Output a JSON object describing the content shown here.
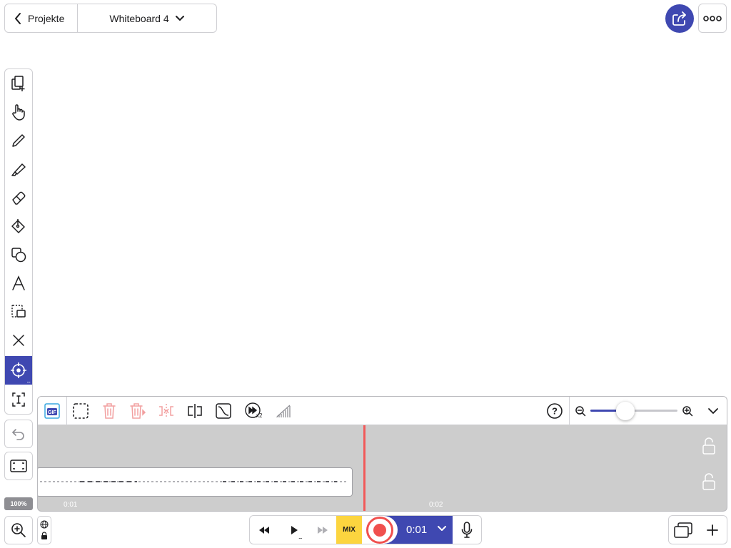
{
  "header": {
    "back_label": "Projekte",
    "title": "Whiteboard 4"
  },
  "toolbar": {
    "tools": [
      "add-page-icon",
      "hand-icon",
      "pen-icon",
      "marker-icon",
      "eraser-icon",
      "fill-bucket-icon",
      "shapes-icon",
      "text-icon",
      "selection-icon",
      "x-icon",
      "laser-pointer-icon",
      "text-cursor-icon"
    ],
    "active_tool": "laser-pointer-icon",
    "active_tool_more": "...",
    "zoom_level": "100%"
  },
  "timeline": {
    "tools": [
      "gif-icon",
      "select-region-icon",
      "delete-icon",
      "delete-right-icon",
      "mirror-icon",
      "split-icon",
      "ease-curve-icon",
      "speed-x2-icon",
      "volume-ramp-icon"
    ],
    "help_label": "?",
    "zoom_slider_fraction": 0.4,
    "time_labels": [
      "0:01",
      "0:02"
    ],
    "speed_badge": "x2"
  },
  "playback": {
    "mix_label": "MIX",
    "time": "0:01",
    "play_more": "..."
  },
  "colors": {
    "accent": "#3f48b1",
    "record": "#f0504e",
    "mix": "#fcd53f",
    "playhead": "#f25a5a"
  }
}
